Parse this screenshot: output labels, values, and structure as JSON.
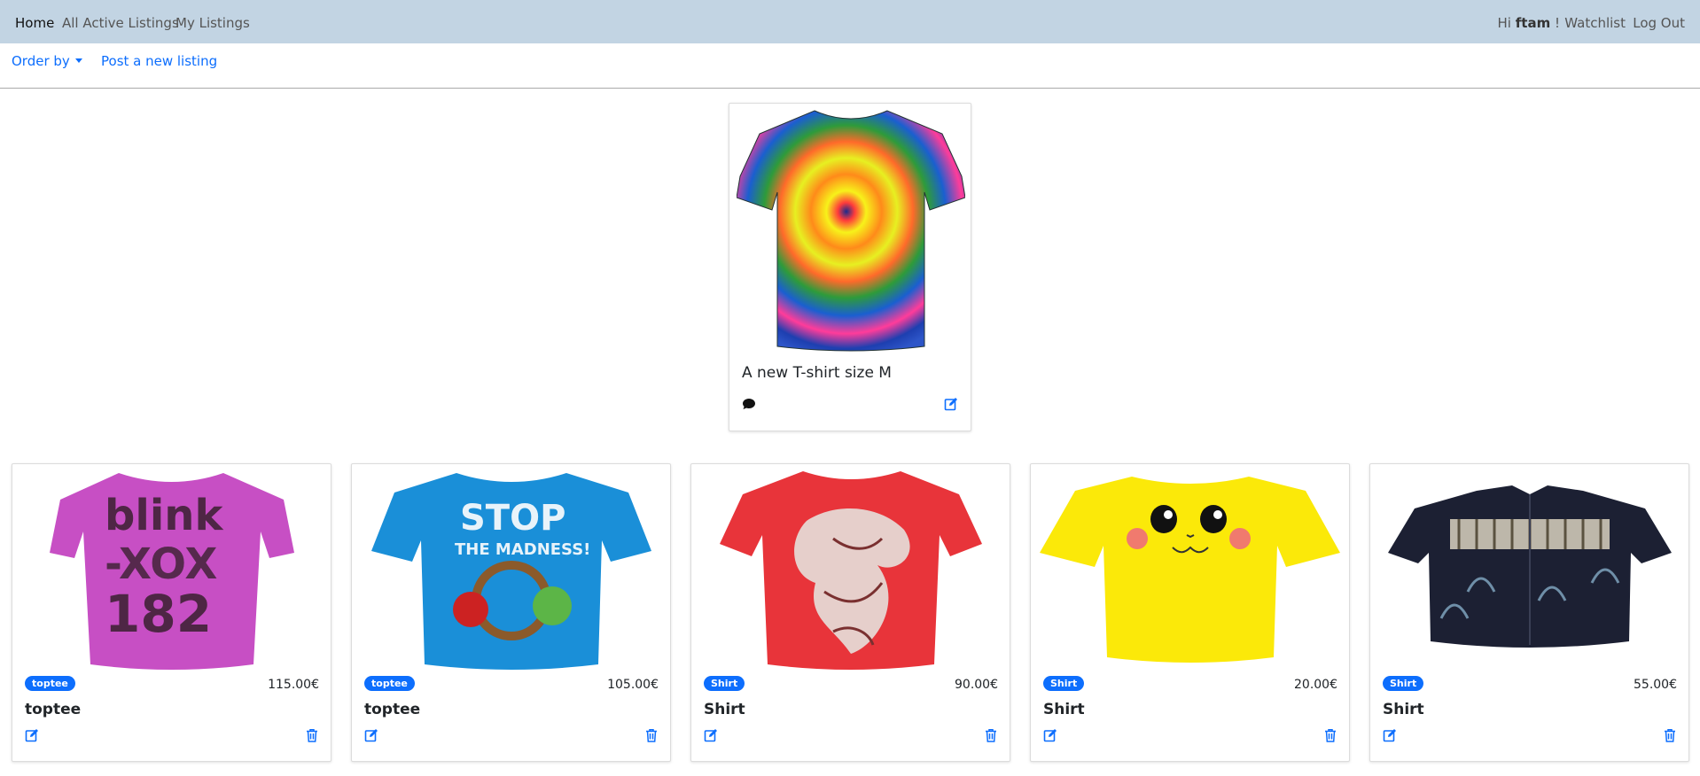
{
  "nav": {
    "home": "Home",
    "all_active": "All Active Listings",
    "my_listings": "My Listings",
    "greeting_prefix": "Hi",
    "username": "ftam",
    "greeting_suffix": "!",
    "watchlist": "Watchlist",
    "logout": "Log Out"
  },
  "toolbar": {
    "order_by": "Order by",
    "post_new": "Post a new listing"
  },
  "featured": {
    "title": "A new T-shirt size M",
    "icons": [
      "comment-icon",
      "edit-icon"
    ],
    "image": "tie-dye-tshirt"
  },
  "listings": [
    {
      "badge": "toptee",
      "price": "115.00€",
      "title": "toptee",
      "image": "pink-blink182-tshirt"
    },
    {
      "badge": "toptee",
      "price": "105.00€",
      "title": "toptee",
      "image": "blue-angry-birds-tshirt"
    },
    {
      "badge": "Shirt",
      "price": "90.00€",
      "title": "Shirt",
      "image": "red-griffin-tshirt"
    },
    {
      "badge": "Shirt",
      "price": "20.00€",
      "title": "Shirt",
      "image": "yellow-pikachu-tshirt"
    },
    {
      "badge": "Shirt",
      "price": "55.00€",
      "title": "Shirt",
      "image": "black-hawaiian-shirt"
    }
  ],
  "colors": {
    "navbar": "#c2d4e3",
    "link": "#0d6efd",
    "badge": "#0d6efd"
  }
}
